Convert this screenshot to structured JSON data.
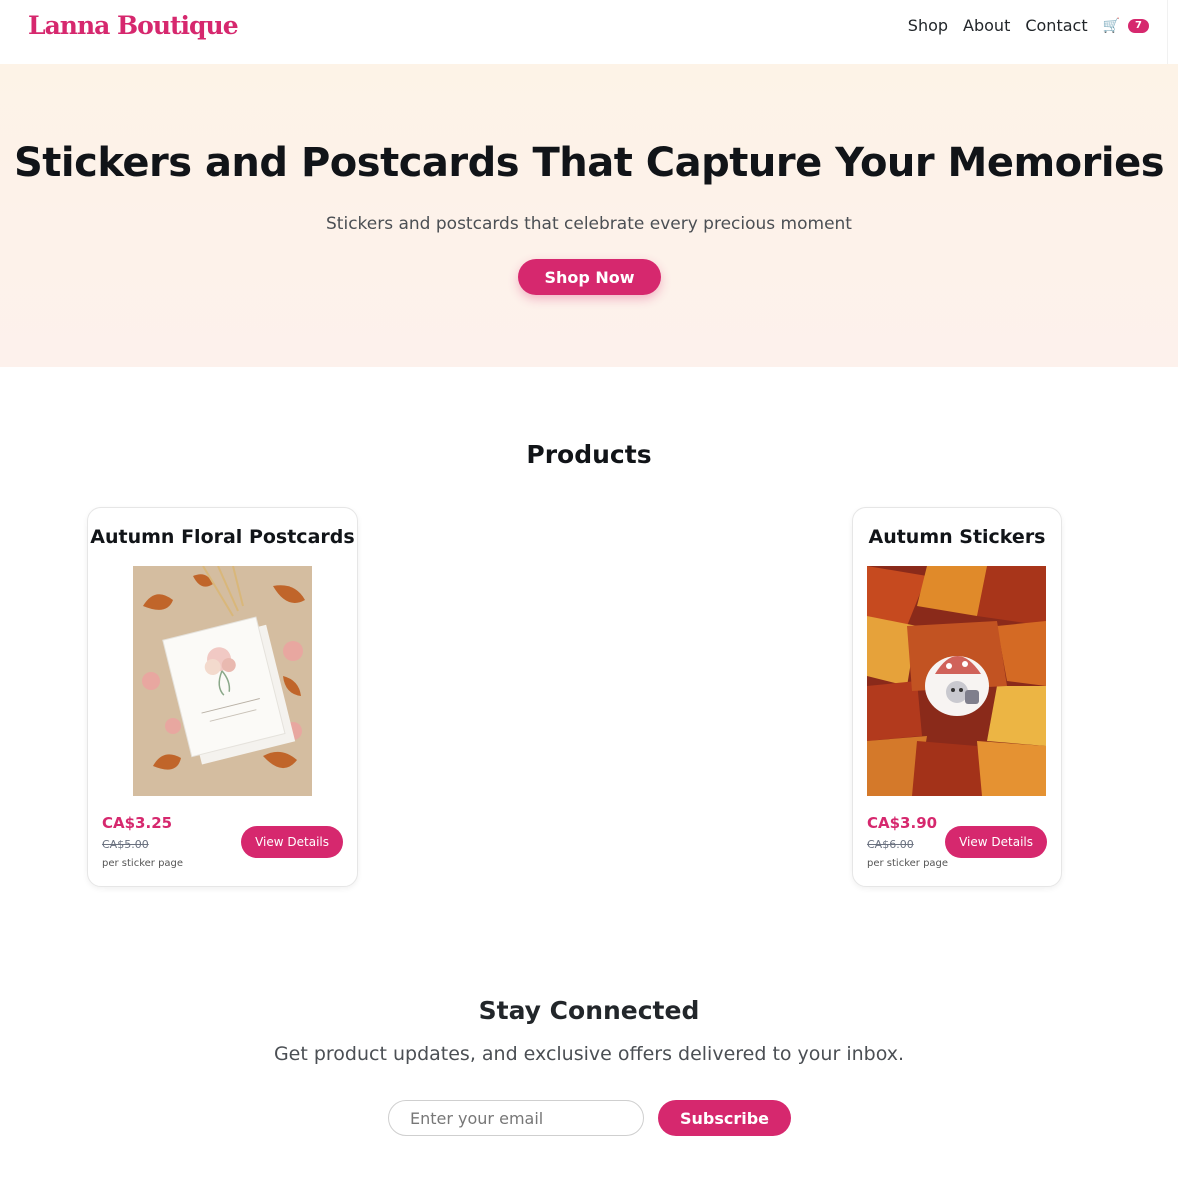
{
  "brand": {
    "name": "Lanna Boutique",
    "accent_color": "#d6286e"
  },
  "nav": {
    "items": [
      {
        "label": "Shop"
      },
      {
        "label": "About"
      },
      {
        "label": "Contact"
      }
    ],
    "cart": {
      "icon": "cart-icon",
      "count": "7"
    }
  },
  "hero": {
    "title": "Stickers and Postcards That Capture Your Memories",
    "subtitle": "Stickers and postcards that celebrate every precious moment",
    "cta_label": "Shop Now"
  },
  "products": {
    "title": "Products",
    "items": [
      {
        "title": "Autumn Floral Postcards",
        "price": "CA$3.25",
        "old_price": "CA$5.00",
        "unit": "per sticker page",
        "button_label": "View Details"
      },
      {
        "title": "Autumn Stickers",
        "price": "CA$3.90",
        "old_price": "CA$6.00",
        "unit": "per sticker page",
        "button_label": "View Details"
      }
    ]
  },
  "newsletter": {
    "title": "Stay Connected",
    "subtitle": "Get product updates, and exclusive offers delivered to your inbox.",
    "email_placeholder": "Enter your email",
    "email_value": "",
    "button_label": "Subscribe"
  }
}
